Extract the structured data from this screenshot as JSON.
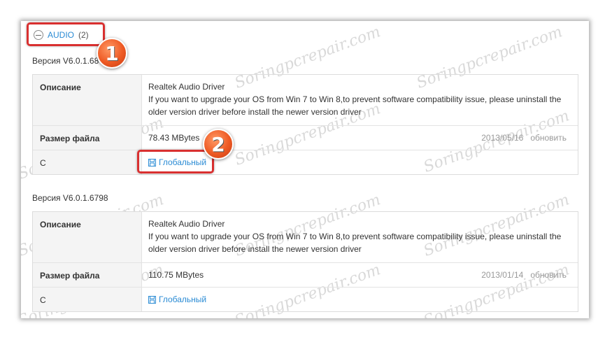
{
  "section": {
    "name": "AUDIO",
    "count": "(2)"
  },
  "labels": {
    "description": "Описание",
    "file_size": "Размер файла",
    "download_row": "С"
  },
  "versions": [
    {
      "version": "Версия V6.0.1.68",
      "description_lines": [
        "Realtek Audio Driver",
        "If you want to upgrade your OS from Win 7 to Win 8,to prevent software compatibility issue, please uninstall the",
        "older version driver before install the newer version driver"
      ],
      "file_size": "78.43 MBytes",
      "date": "2013/05/16",
      "update": "обновить",
      "download": "Глобальный"
    },
    {
      "version": "Версия V6.0.1.6798",
      "description_lines": [
        "Realtek Audio Driver",
        "If you want to upgrade your OS from Win 7 to Win 8,to prevent software compatibility issue, please uninstall the",
        "older version driver before install the newer version driver"
      ],
      "file_size": "110.75 MBytes",
      "date": "2013/01/14",
      "update": "обновить",
      "download": "Глобальный"
    }
  ],
  "markers": [
    "1",
    "2"
  ],
  "watermark": "Soringpcrepair.com",
  "colors": {
    "link": "#2a8bd4",
    "highlight": "#d93030",
    "marker": "#ee5a24"
  }
}
